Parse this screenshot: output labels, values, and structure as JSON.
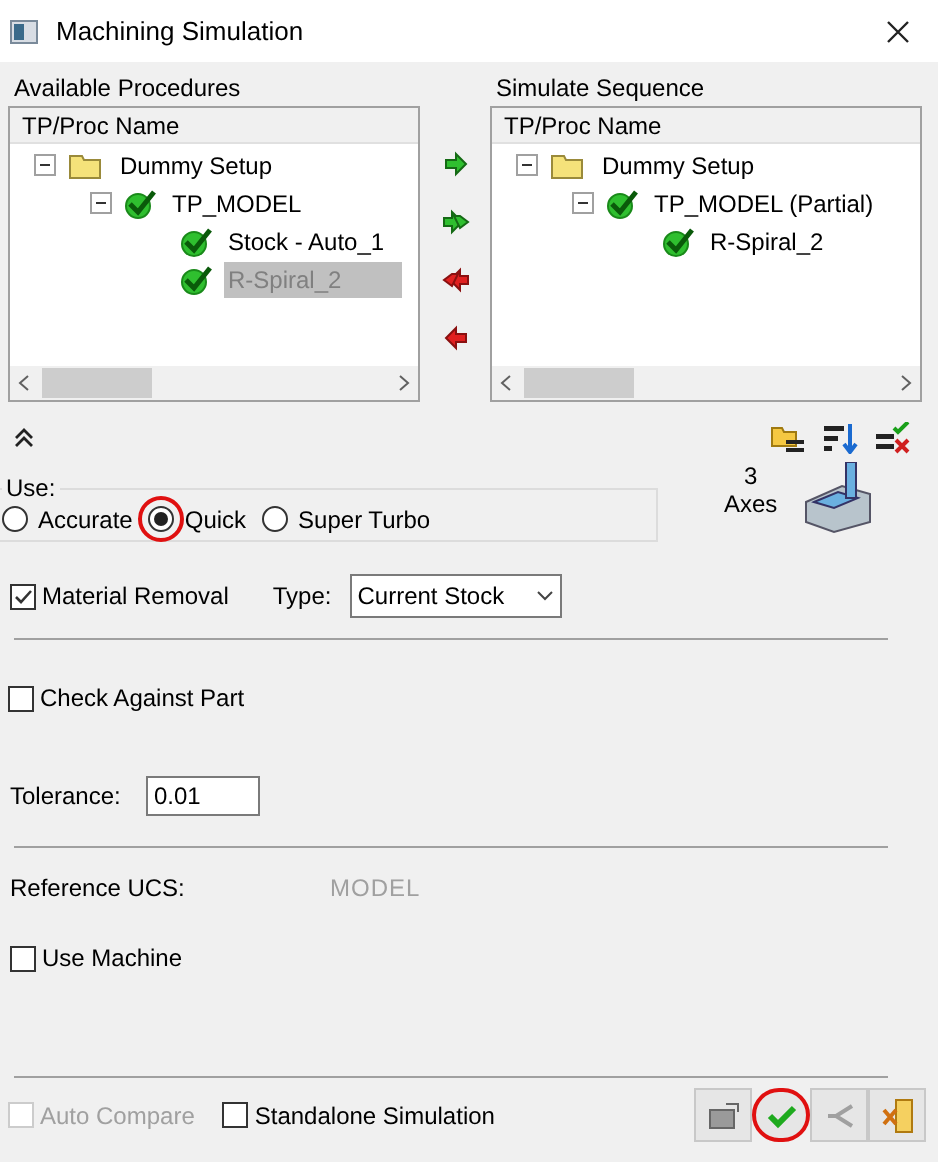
{
  "window": {
    "title": "Machining Simulation"
  },
  "available": {
    "label": "Available Procedures",
    "column": "TP/Proc Name",
    "tree": [
      {
        "label": "Dummy Setup",
        "kind": "folder",
        "expanded": true,
        "selected": false,
        "children": [
          {
            "label": "TP_MODEL",
            "kind": "check",
            "expanded": true,
            "selected": false,
            "children": [
              {
                "label": "Stock - Auto_1",
                "kind": "check",
                "selected": false
              },
              {
                "label": "R-Spiral_2",
                "kind": "check",
                "selected": true
              }
            ]
          }
        ]
      }
    ]
  },
  "transfer_buttons": [
    {
      "kind": "add"
    },
    {
      "kind": "add_all"
    },
    {
      "kind": "remove_all"
    },
    {
      "kind": "remove"
    }
  ],
  "sequence": {
    "label": "Simulate Sequence",
    "column": "TP/Proc Name",
    "tree": [
      {
        "label": "Dummy Setup",
        "kind": "folder",
        "expanded": true,
        "selected": false,
        "children": [
          {
            "label": "TP_MODEL (Partial)",
            "kind": "check",
            "expanded": true,
            "selected": false,
            "children": [
              {
                "label": "R-Spiral_2",
                "kind": "check",
                "selected": false
              }
            ]
          }
        ]
      }
    ]
  },
  "use": {
    "label": "Use:",
    "options": [
      {
        "label": "Accurate",
        "selected": false,
        "circled": false
      },
      {
        "label": "Quick",
        "selected": true,
        "circled": true
      },
      {
        "label": "Super Turbo",
        "selected": false,
        "circled": false
      }
    ]
  },
  "axes": {
    "count": "3",
    "label": "Axes"
  },
  "material_removal": {
    "label": "Material Removal",
    "checked": true,
    "type_label": "Type:",
    "type_value": "Current Stock"
  },
  "check_against_part": {
    "label": "Check Against Part",
    "checked": false
  },
  "tolerance": {
    "label": "Tolerance:",
    "value": "0.01"
  },
  "reference_ucs": {
    "label": "Reference UCS:",
    "value": "MODEL"
  },
  "use_machine": {
    "label": "Use Machine",
    "checked": false
  },
  "auto_compare": {
    "label": "Auto Compare",
    "checked": false,
    "disabled": true
  },
  "standalone": {
    "label": "Standalone Simulation",
    "checked": false,
    "disabled": false
  },
  "bottom_buttons": [
    {
      "kind": "machine",
      "disabled": false,
      "circled": false
    },
    {
      "kind": "ok",
      "disabled": false,
      "circled": true
    },
    {
      "kind": "apply",
      "disabled": true,
      "circled": false
    },
    {
      "kind": "cancel",
      "disabled": false,
      "circled": false
    }
  ]
}
